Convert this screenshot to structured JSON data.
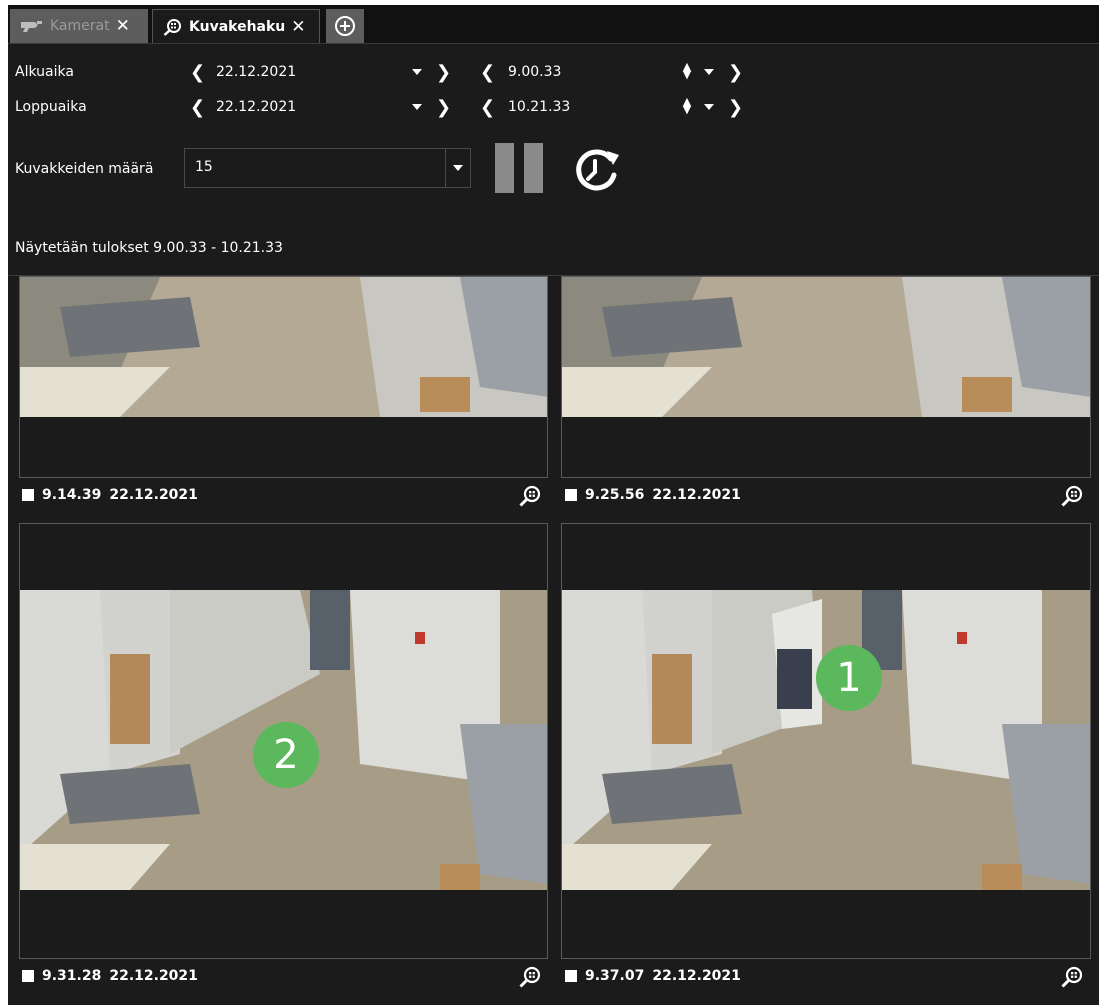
{
  "tabs": [
    {
      "label": "Kamerat",
      "icon": "camera-icon"
    },
    {
      "label": "Kuvakehaku",
      "icon": "thumbnail-search-icon"
    }
  ],
  "start": {
    "label": "Alkuaika",
    "date": "22.12.2021",
    "time": "9.00.33"
  },
  "end": {
    "label": "Loppuaika",
    "date": "22.12.2021",
    "time": "10.21.33"
  },
  "count": {
    "label": "Kuvakkeiden määrä",
    "value": "15"
  },
  "results_text": "Näytetään tulokset 9.00.33 - 10.21.33",
  "thumbnails": [
    {
      "time": "9.14.39",
      "date": "22.12.2021"
    },
    {
      "time": "9.25.56",
      "date": "22.12.2021"
    },
    {
      "time": "9.31.28",
      "date": "22.12.2021",
      "badge": "2"
    },
    {
      "time": "9.37.07",
      "date": "22.12.2021",
      "badge": "1"
    }
  ],
  "colors": {
    "background": "#1b1b1b",
    "badge": "#5cb85c",
    "tab_inactive": "#5d5d5d"
  }
}
